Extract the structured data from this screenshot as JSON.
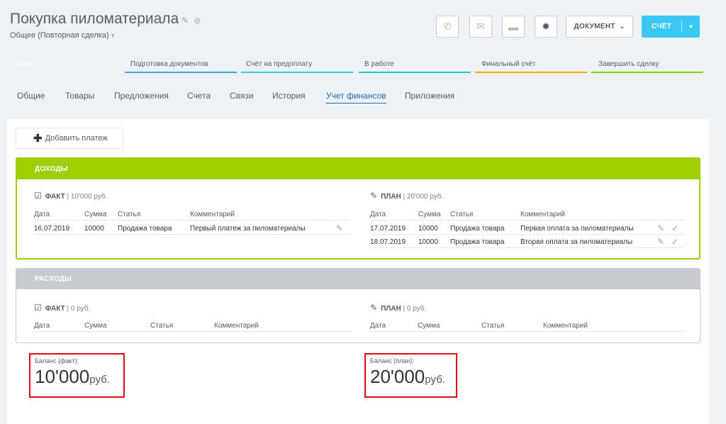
{
  "header": {
    "title": "Покупка пиломатериала",
    "subtitle": "Общее (Повторная сделка)",
    "document_label": "ДОКУМЕНТ",
    "invoice_label": "СЧЁТ"
  },
  "stages": [
    {
      "label": "Новая",
      "color": "#39a8ef"
    },
    {
      "label": "Подготовка документов",
      "color": "#39a8ef"
    },
    {
      "label": "Счёт на предоплату",
      "color": "#3bc8f5"
    },
    {
      "label": "В работе",
      "color": "#2fc6c6"
    },
    {
      "label": "Финальный счёт",
      "color": "#f7a700"
    },
    {
      "label": "Завершить сделку",
      "color": "#7bd500"
    }
  ],
  "tabs": [
    "Общие",
    "Товары",
    "Предложения",
    "Счета",
    "Связи",
    "История",
    "Учет финансов",
    "Приложения"
  ],
  "add_payment_label": "Добавить платеж",
  "income": {
    "title": "ДОХОДЫ",
    "fact": {
      "label": "ФАКТ",
      "amount": "10'000 руб."
    },
    "plan": {
      "label": "ПЛАН",
      "amount": "20'000 руб."
    },
    "columns": [
      "Дата",
      "Сумма",
      "Статья",
      "Комментарий"
    ],
    "fact_rows": [
      {
        "date": "16.07.2019",
        "sum": "10000",
        "item": "Продажа товара",
        "comment": "Первый платеж за пиломатериалы"
      }
    ],
    "plan_rows": [
      {
        "date": "17.07.2019",
        "sum": "10000",
        "item": "Продажа товара",
        "comment": "Первая оплата за пиломатериалы"
      },
      {
        "date": "18.07.2019",
        "sum": "10000",
        "item": "Продажа товара",
        "comment": "Вторая оплата за пиломатериалы"
      }
    ]
  },
  "expense": {
    "title": "РАСХОДЫ",
    "fact": {
      "label": "ФАКТ",
      "amount": "0 руб."
    },
    "plan": {
      "label": "ПЛАН",
      "amount": "0 руб."
    },
    "columns": [
      "Дата",
      "Сумма",
      "Статья",
      "Комментарий"
    ]
  },
  "balance": {
    "fact": {
      "label": "Баланс (факт):",
      "value": "10'000",
      "currency": "руб."
    },
    "plan": {
      "label": "Баланс (план):",
      "value": "20'000",
      "currency": "руб."
    }
  },
  "icons": {
    "pencil": "pencil-icon",
    "link": "link-icon",
    "phone": "phone-icon",
    "mail": "mail-icon",
    "chat": "chat-icon",
    "gear": "gear-icon",
    "check": "check-icon"
  }
}
